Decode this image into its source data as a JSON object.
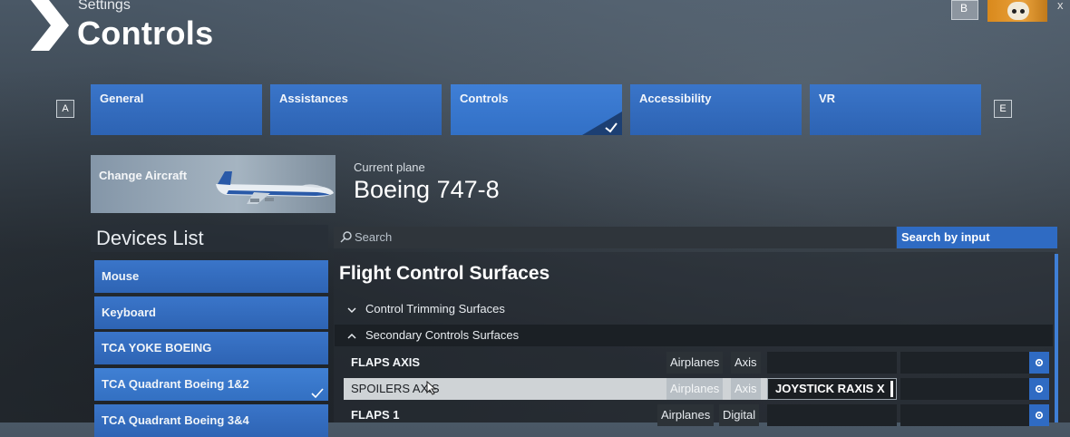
{
  "header": {
    "section": "Settings",
    "title": "Controls",
    "top_button": "B"
  },
  "tab_hints": {
    "left": "A",
    "right": "E"
  },
  "tabs": [
    {
      "label": "General",
      "active": false
    },
    {
      "label": "Assistances",
      "active": false
    },
    {
      "label": "Controls",
      "active": true
    },
    {
      "label": "Accessibility",
      "active": false
    },
    {
      "label": "VR",
      "active": false
    }
  ],
  "aircraft": {
    "change_label": "Change Aircraft",
    "current_label": "Current plane",
    "current_value": "Boeing 747-8"
  },
  "devices": {
    "title": "Devices List",
    "items": [
      {
        "label": "Mouse",
        "selected": false
      },
      {
        "label": "Keyboard",
        "selected": false
      },
      {
        "label": "TCA YOKE BOEING",
        "selected": false
      },
      {
        "label": "TCA Quadrant Boeing 1&2",
        "selected": true
      },
      {
        "label": "TCA Quadrant Boeing 3&4",
        "selected": false
      }
    ]
  },
  "search": {
    "placeholder": "Search",
    "by_input_label": "Search by input"
  },
  "content": {
    "section_title": "Flight Control Surfaces",
    "groups": [
      {
        "label": "Control Trimming Surfaces",
        "expanded": false
      },
      {
        "label": "Secondary Controls Surfaces",
        "expanded": true
      }
    ],
    "bindings": [
      {
        "name": "FLAPS AXIS",
        "category": "Airplanes",
        "type": "Axis",
        "input1": "",
        "input2": "",
        "highlighted": false
      },
      {
        "name": "SPOILERS AXIS",
        "category": "Airplanes",
        "type": "Axis",
        "input1": "JOYSTICK RAXIS X",
        "input2": "",
        "highlighted": true
      },
      {
        "name": "FLAPS 1",
        "category": "Airplanes",
        "type": "Digital",
        "input1": "",
        "input2": "",
        "highlighted": false
      }
    ]
  },
  "colors": {
    "accent_blue": "#2f6bc3",
    "panel_dark": "#2f353b"
  },
  "icons": [
    "chevron-logo-icon",
    "check-icon",
    "search-icon",
    "chevron-down-icon",
    "chevron-up-icon",
    "gear-icon",
    "plane-image",
    "mouse-pointer-icon"
  ]
}
